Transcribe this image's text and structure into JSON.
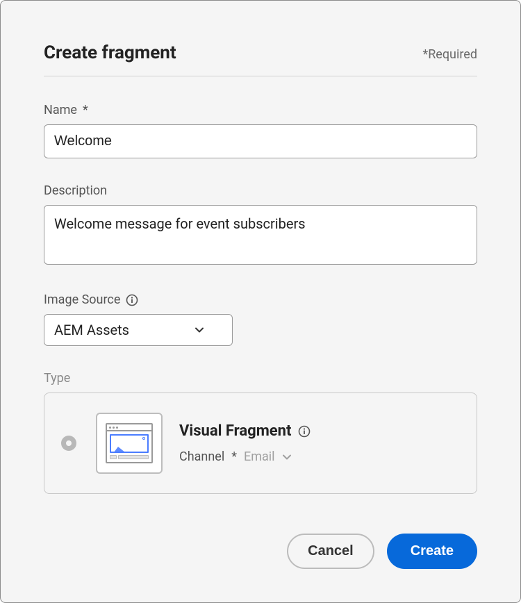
{
  "header": {
    "title": "Create fragment",
    "required_note": "*Required"
  },
  "name_field": {
    "label": "Name",
    "required_marker": "*",
    "value": "Welcome"
  },
  "description_field": {
    "label": "Description",
    "value": "Welcome message for event subscribers"
  },
  "image_source_field": {
    "label": "Image Source",
    "value": "AEM Assets"
  },
  "type_section": {
    "label": "Type",
    "option": {
      "title": "Visual Fragment",
      "channel_label": "Channel",
      "channel_required_marker": "*",
      "channel_value": "Email"
    }
  },
  "footer": {
    "cancel_label": "Cancel",
    "create_label": "Create"
  }
}
